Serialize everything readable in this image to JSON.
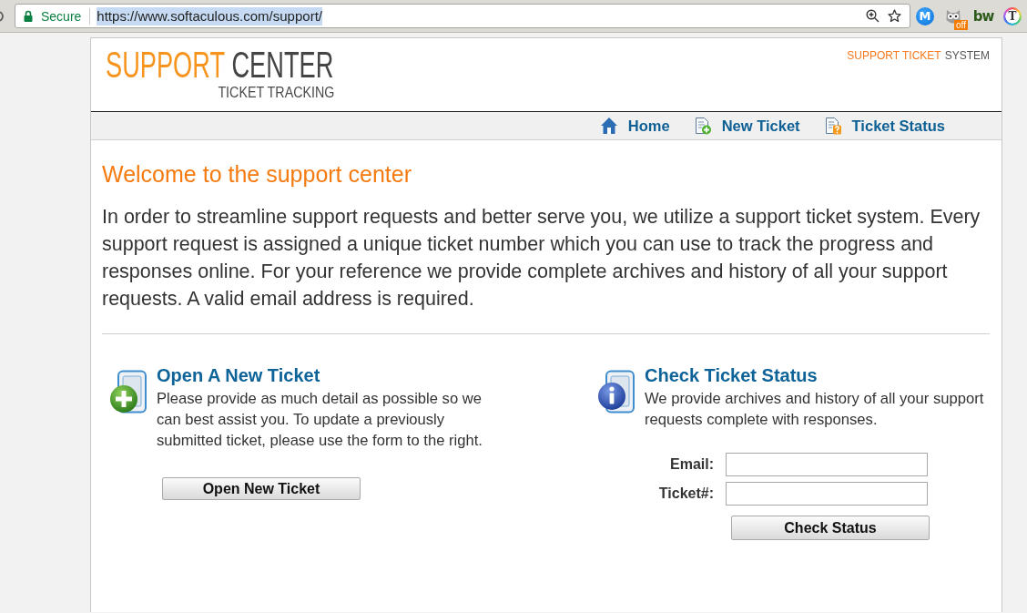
{
  "browser": {
    "security_label": "Secure",
    "url": "https://www.softaculous.com/support/",
    "url_selected": true,
    "extensions": [
      {
        "kind": "circle",
        "label": "M"
      },
      {
        "kind": "owl",
        "label": "off"
      },
      {
        "kind": "wordmark",
        "label": "bw"
      },
      {
        "kind": "ring",
        "label": "T"
      }
    ]
  },
  "header": {
    "logo": {
      "first_word": "SUPPORT",
      "second_word": "CENTER",
      "subtitle": "TICKET TRACKING"
    },
    "tagline": {
      "highlight": "SUPPORT TICKET",
      "rest": "SYSTEM"
    }
  },
  "nav": [
    {
      "kind": "home",
      "label": "Home"
    },
    {
      "kind": "new",
      "label": "New Ticket"
    },
    {
      "kind": "status",
      "label": "Ticket Status"
    }
  ],
  "welcome": {
    "title": "Welcome to the support center",
    "text": "In order to streamline support requests and better serve you, we utilize a support ticket system. Every support request is assigned a unique ticket number which you can use to track the progress and responses online. For your reference we provide complete archives and history of all your support requests. A valid email address is required."
  },
  "sections": [
    {
      "kind": "open",
      "title": "Open A New Ticket",
      "text": "Please provide as much detail as possible so we can best assist you. To update a previously submitted ticket, please use the form to the right.",
      "button": "Open New Ticket"
    },
    {
      "kind": "check",
      "title": "Check Ticket Status",
      "text": "We provide archives and history of all your support requests complete with responses.",
      "fields": [
        {
          "label": "Email:"
        },
        {
          "label": "Ticket#:"
        }
      ],
      "button": "Check Status"
    }
  ]
}
